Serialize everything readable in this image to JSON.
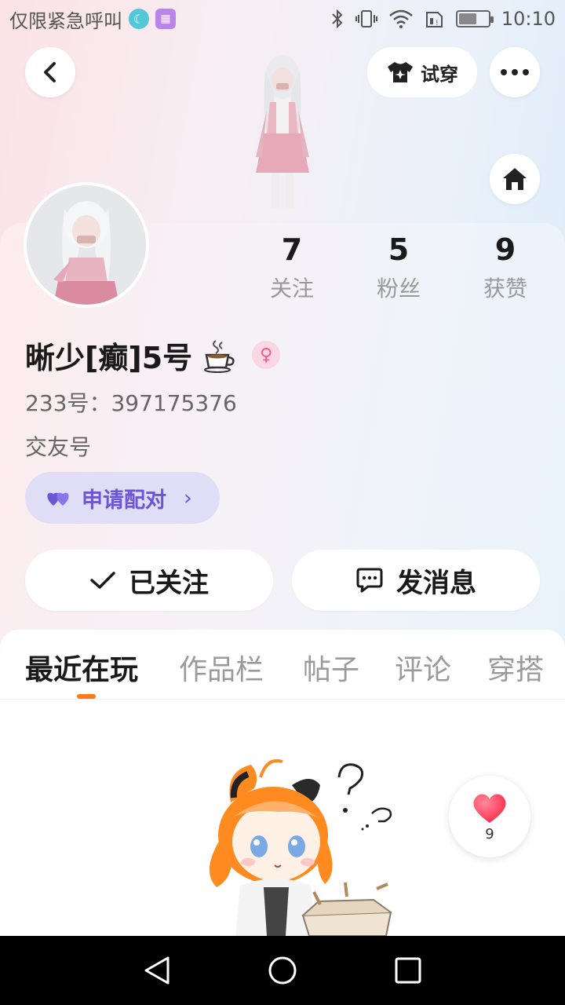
{
  "status_bar": {
    "left_text": "仅限紧急呼叫",
    "time": "10:10",
    "battery_level": 0.55,
    "icons": [
      "moon-icon",
      "picture-icon",
      "bluetooth-icon",
      "vibrate-icon",
      "wifi-icon",
      "sim-icon",
      "battery-icon"
    ]
  },
  "header": {
    "tryon_label": "试穿",
    "icons": [
      "back-icon",
      "tshirt-icon",
      "more-icon",
      "home-icon"
    ]
  },
  "stats": [
    {
      "value": "7",
      "label": "关注"
    },
    {
      "value": "5",
      "label": "粉丝"
    },
    {
      "value": "9",
      "label": "获赞"
    }
  ],
  "profile": {
    "name": "晰少[癫]5号",
    "id_text": "233号：397175376",
    "friend_label": "交友号",
    "gender_symbol": "♀"
  },
  "buttons": {
    "pair": "申请配对",
    "following": "已关注",
    "message": "发消息"
  },
  "tabs": [
    {
      "label": "最近在玩",
      "active": true
    },
    {
      "label": "作品栏",
      "active": false
    },
    {
      "label": "帖子",
      "active": false
    },
    {
      "label": "评论",
      "active": false
    },
    {
      "label": "穿搭",
      "active": false
    }
  ],
  "like": {
    "count": "9"
  },
  "colors": {
    "accent_orange": "#ff7a1f",
    "pair_purple": "#6c55d6",
    "like_red": "#ff3b55"
  }
}
